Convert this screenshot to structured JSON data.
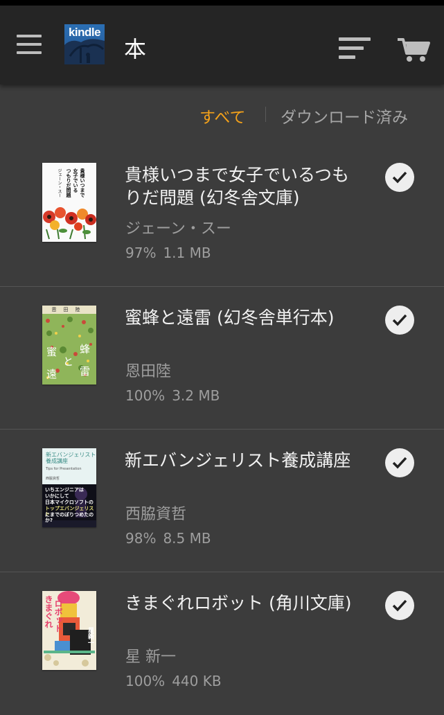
{
  "app": {
    "logo_text": "kindle",
    "title": "本"
  },
  "icons": {
    "menu": "hamburger-menu-icon",
    "sort": "sort-icon",
    "cart": "cart-icon",
    "check": "check-circle-icon"
  },
  "filters": {
    "all": "すべて",
    "downloaded": "ダウンロード済み",
    "active": "all",
    "active_color": "#f3a11a"
  },
  "books": [
    {
      "title": "貴様いつまで女子でいるつもりだ問題 (幻冬舎文庫)",
      "author": "ジェーン・スー",
      "progress": "97%",
      "size": "1.1 MB",
      "downloaded": true,
      "cover_text": [
        "貴様いつまで",
        "女子でいる",
        "つもりだ問題",
        "ジェーン・スー"
      ]
    },
    {
      "title": "蜜蜂と遠雷 (幻冬舎単行本)",
      "author": "恩田陸",
      "progress": "100%",
      "size": "3.2 MB",
      "downloaded": true,
      "cover_text": [
        "恩田陸",
        "蜂",
        "蜜",
        "雷",
        "遠",
        "と"
      ]
    },
    {
      "title": "新エバンジェリスト養成講座",
      "author": "西脇資哲",
      "progress": "98%",
      "size": "8.5 MB",
      "downloaded": true,
      "cover_text": [
        "新エバンジェリスト",
        "養成講座",
        "Tips for Presentation",
        "西脇資哲",
        "いちエンジニアは",
        "いかにして",
        "日本マイクロソフトの",
        "トップエバンジェリスト",
        "にまでのぼりつめたのか?"
      ]
    },
    {
      "title": "きまぐれロボット (角川文庫)",
      "author": "星 新一",
      "progress": "100%",
      "size": "440 KB",
      "downloaded": true,
      "cover_text": [
        "きまぐれ",
        "ロボット",
        "星新一"
      ]
    }
  ]
}
